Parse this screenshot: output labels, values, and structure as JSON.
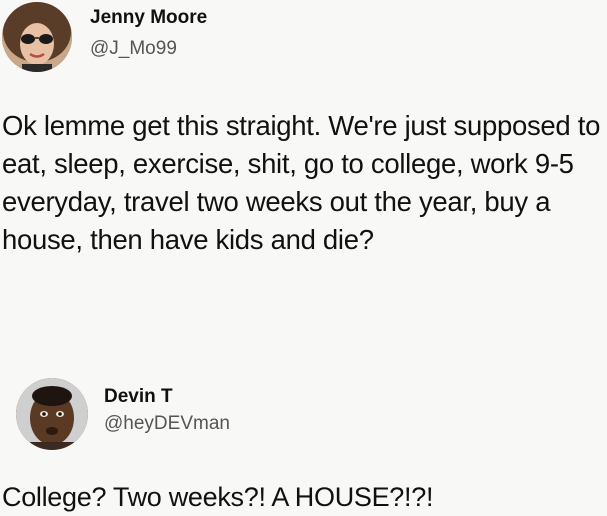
{
  "tweets": [
    {
      "author_name": "Jenny Moore",
      "handle": "@J_Mo99",
      "text": "Ok lemme get this straight. We're just supposed to eat, sleep, exercise, shit, go to college, work 9-5 everyday, travel two weeks out the year, buy a house, then have kids and die?"
    },
    {
      "author_name": "Devin T",
      "handle": "@heyDEVman",
      "text": "College? Two weeks?! A HOUSE?!?!"
    }
  ]
}
